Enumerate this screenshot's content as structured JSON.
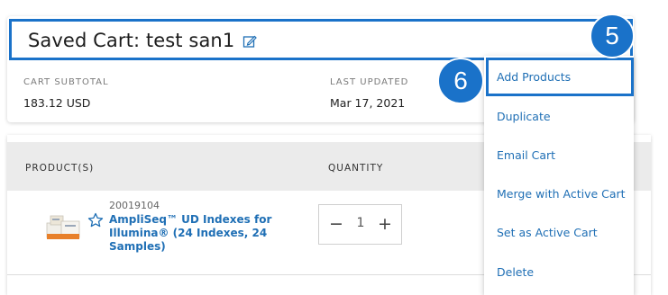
{
  "header": {
    "title": "Saved Cart: test san1",
    "subtotal_label": "CART SUBTOTAL",
    "subtotal_value": "183.12 USD",
    "updated_label": "LAST UPDATED",
    "updated_value": "Mar 17, 2021"
  },
  "table": {
    "columns": [
      "PRODUCT(S)",
      "QUANTITY"
    ],
    "rows": [
      {
        "code": "20019104",
        "name_line1": "AmpliSeq™ UD Indexes for",
        "name_line2": "Illumina® (24 Indexes, 24",
        "name_line3": "Samples)",
        "quantity": "1"
      }
    ]
  },
  "stepper": {
    "minus": "−",
    "plus": "+"
  },
  "menu": {
    "items": [
      "Add Products",
      "Duplicate",
      "Email Cart",
      "Merge with Active Cart",
      "Set as Active Cart",
      "Delete"
    ]
  },
  "callouts": [
    "5",
    "6"
  ],
  "colors": {
    "accent": "#1a72c9",
    "link": "#1f6fb5",
    "header_bg": "#ebebeb"
  },
  "icons": [
    "edit-icon",
    "star-icon",
    "product-thumbnail"
  ]
}
